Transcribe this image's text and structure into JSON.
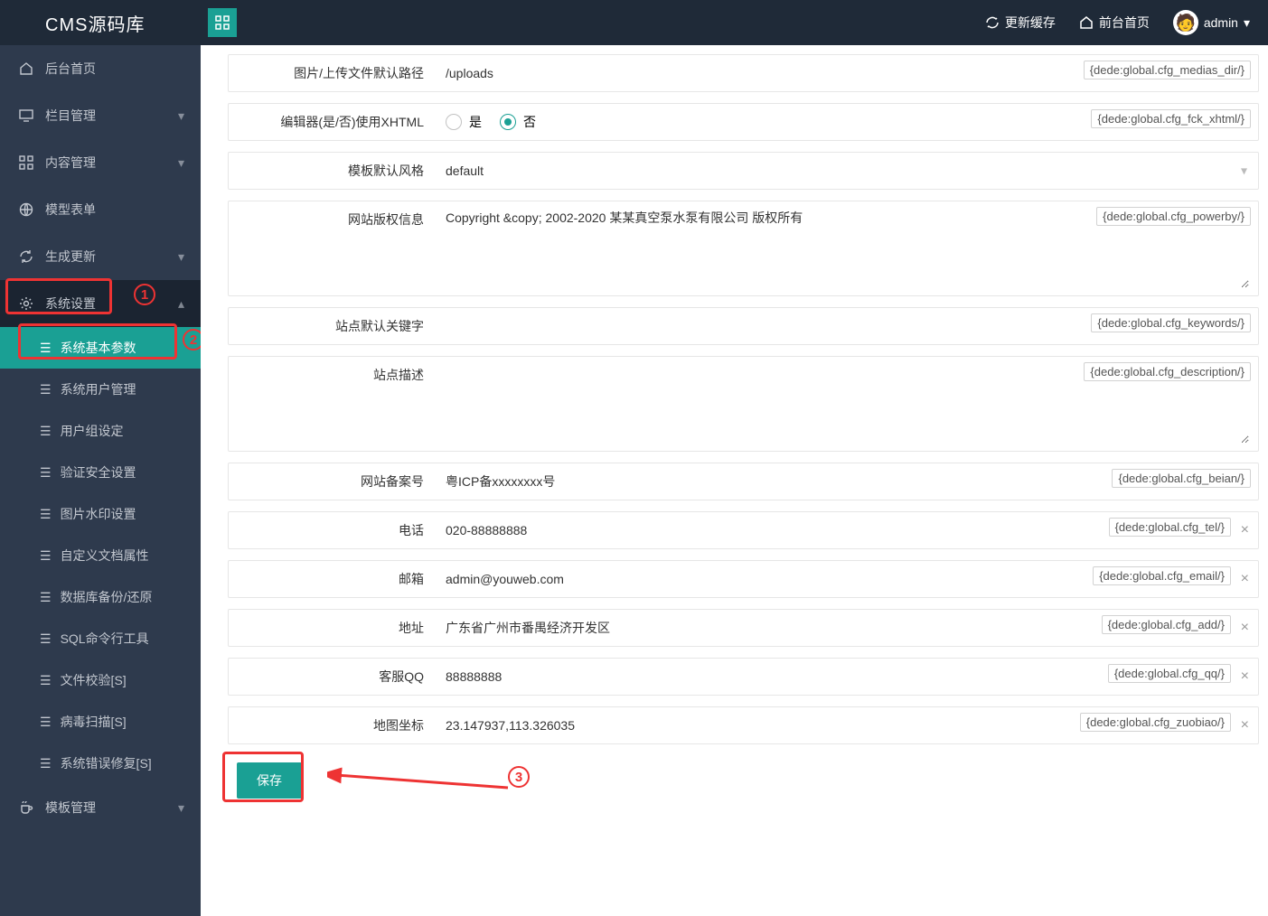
{
  "header": {
    "brand": "CMS源码库",
    "cache_link": "更新缓存",
    "front_link": "前台首页",
    "username": "admin"
  },
  "sidebar": {
    "home": "后台首页",
    "column": "栏目管理",
    "content": "内容管理",
    "model": "模型表单",
    "generate": "生成更新",
    "system": "系统设置",
    "template": "模板管理",
    "sub": {
      "basic": "系统基本参数",
      "user": "系统用户管理",
      "group": "用户组设定",
      "verify": "验证安全设置",
      "watermark": "图片水印设置",
      "docattr": "自定义文档属性",
      "dbbackup": "数据库备份/还原",
      "sql": "SQL命令行工具",
      "filecheck": "文件校验[S]",
      "virus": "病毒扫描[S]",
      "errfix": "系统错误修复[S]"
    }
  },
  "form": {
    "rows": {
      "upload_path": {
        "label": "图片/上传文件默认路径",
        "value": "/uploads",
        "tag": "{dede:global.cfg_medias_dir/}"
      },
      "xhtml": {
        "label": "编辑器(是/否)使用XHTML",
        "yes": "是",
        "no": "否",
        "tag": "{dede:global.cfg_fck_xhtml/}"
      },
      "template": {
        "label": "模板默认风格",
        "value": "default"
      },
      "copyright": {
        "label": "网站版权信息",
        "value": "Copyright &copy; 2002-2020 某某真空泵水泵有限公司 版权所有",
        "tag": "{dede:global.cfg_powerby/}"
      },
      "keywords": {
        "label": "站点默认关键字",
        "value": "",
        "tag": "{dede:global.cfg_keywords/}"
      },
      "description": {
        "label": "站点描述",
        "value": "",
        "tag": "{dede:global.cfg_description/}"
      },
      "beian": {
        "label": "网站备案号",
        "value": "粤ICP备xxxxxxxx号",
        "tag": "{dede:global.cfg_beian/}"
      },
      "tel": {
        "label": "电话",
        "value": "020-88888888",
        "tag": "{dede:global.cfg_tel/}"
      },
      "email": {
        "label": "邮箱",
        "value": "admin@youweb.com",
        "tag": "{dede:global.cfg_email/}"
      },
      "address": {
        "label": "地址",
        "value": "广东省广州市番禺经济开发区",
        "tag": "{dede:global.cfg_add/}"
      },
      "qq": {
        "label": "客服QQ",
        "value": "88888888",
        "tag": "{dede:global.cfg_qq/}"
      },
      "zuobiao": {
        "label": "地图坐标",
        "value": "23.147937,113.326035",
        "tag": "{dede:global.cfg_zuobiao/}"
      }
    },
    "save": "保存"
  }
}
